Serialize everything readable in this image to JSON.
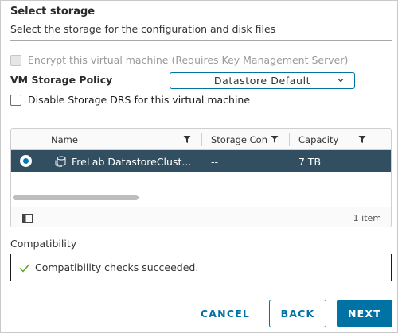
{
  "section": {
    "title": "Select storage",
    "subtitle": "Select the storage for the configuration and disk files"
  },
  "options": {
    "encrypt_label": "Encrypt this virtual machine (Requires Key Management Server)",
    "encrypt_checked": false,
    "encrypt_disabled": true,
    "policy_label": "VM Storage Policy",
    "policy_value": "Datastore Default",
    "disable_drs_label": "Disable Storage DRS for this virtual machine",
    "disable_drs_checked": false
  },
  "grid": {
    "columns": [
      "Name",
      "Storage Compatibility",
      "Capacity"
    ],
    "column_visible_text": [
      "Name",
      "Storage Con",
      "Capacity"
    ],
    "rows": [
      {
        "name": "FreLab DatastoreClust...",
        "storage_compat": "--",
        "capacity": "7 TB",
        "selected": true,
        "icon": "datastore-cluster-icon"
      }
    ],
    "footer_count": "1 item"
  },
  "compatibility": {
    "label": "Compatibility",
    "message": "Compatibility checks succeeded.",
    "status_icon": "checkmark-icon"
  },
  "buttons": {
    "cancel": "CANCEL",
    "back": "BACK",
    "next": "NEXT"
  },
  "colors": {
    "accent": "#0072a3",
    "selected_row": "#324f61",
    "success": "#5aa220"
  }
}
